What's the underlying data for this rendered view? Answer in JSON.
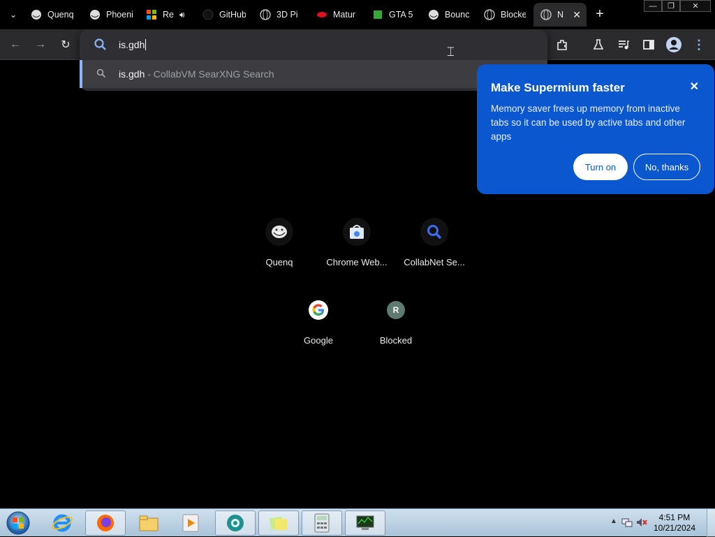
{
  "tabs": [
    {
      "title": "Quenq",
      "icon": "troll-face-icon"
    },
    {
      "title": "Phoenix",
      "icon": "troll-face-icon"
    },
    {
      "title": "Re",
      "icon": "windows-flag-icon",
      "audio": "speaker-icon"
    },
    {
      "title": "GitHub",
      "icon": "github-icon"
    },
    {
      "title": "3D Pi",
      "icon": "globe-icon"
    },
    {
      "title": "Matur",
      "icon": "red-lips-icon"
    },
    {
      "title": "GTA 5",
      "icon": "gta-icon"
    },
    {
      "title": "Bounc",
      "icon": "troll-face-icon"
    },
    {
      "title": "Blocke",
      "icon": "globe-icon"
    },
    {
      "title": "N",
      "icon": "globe-icon",
      "active": true
    }
  ],
  "window": {
    "minimize": "—",
    "maximize": "❐",
    "close": "✕"
  },
  "omnibox": {
    "value": "is.gdh",
    "suggestion": {
      "query": "is.gdh",
      "description": " - CollabVM SearXNG Search"
    }
  },
  "promo": {
    "title": "Make Supermium faster",
    "body": "Memory saver frees up memory from inactive tabs so it can be used by active tabs and other apps",
    "turn_on": "Turn on",
    "no_thanks": "No, thanks",
    "close": "✕"
  },
  "shortcuts": [
    {
      "label": "Quenq",
      "icon": "troll-face-icon"
    },
    {
      "label": "Chrome Web...",
      "icon": "chrome-web-store-icon"
    },
    {
      "label": "CollabNet Se...",
      "icon": "search-icon"
    },
    {
      "label": "Google",
      "icon": "google-icon"
    },
    {
      "label": "Blocked",
      "icon": "letter-r-icon",
      "letter": "R"
    }
  ],
  "taskbar": {
    "items": [
      "internet-explorer-icon",
      "firefox-icon",
      "file-explorer-icon",
      "media-player-icon",
      "browser-icon",
      "sticky-notes-icon",
      "calculator-icon",
      "system-monitor-icon"
    ],
    "time": "4:51 PM",
    "date": "10/21/2024"
  },
  "colors": {
    "accent": "#0b57d0",
    "tab_bg": "#2b2b2e",
    "highlight": "#8ab4f8"
  }
}
